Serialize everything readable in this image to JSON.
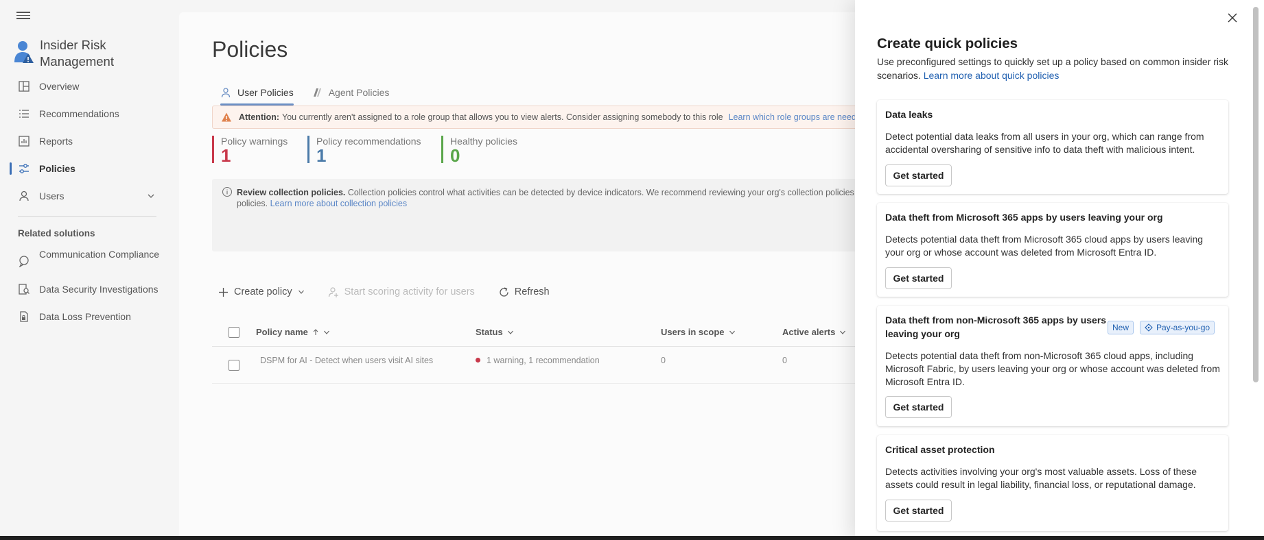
{
  "app": {
    "title": "Insider Risk Management"
  },
  "nav": {
    "items": [
      {
        "label": "Overview",
        "icon": "overview-icon"
      },
      {
        "label": "Recommendations",
        "icon": "list-icon"
      },
      {
        "label": "Reports",
        "icon": "chart-icon"
      },
      {
        "label": "Policies",
        "icon": "sliders-icon",
        "active": true
      },
      {
        "label": "Users",
        "icon": "person-icon",
        "expandable": true
      }
    ],
    "related_title": "Related solutions",
    "related": [
      {
        "label": "Communication Compliance",
        "icon": "chat-icon"
      },
      {
        "label": "Data Security Investigations",
        "icon": "investigate-icon"
      },
      {
        "label": "Data Loss Prevention",
        "icon": "lock-doc-icon"
      }
    ]
  },
  "main": {
    "title": "Policies",
    "tabs": [
      {
        "label": "User Policies",
        "active": true
      },
      {
        "label": "Agent Policies",
        "active": false
      }
    ],
    "attention": {
      "prefix": "Attention:",
      "text": "You currently aren't assigned to a role group that allows you to view alerts. Consider assigning somebody to this role",
      "link": "Learn which role groups are needed to re"
    },
    "stats": [
      {
        "label": "Policy warnings",
        "value": "1",
        "color": "#c8384a"
      },
      {
        "label": "Policy recommendations",
        "value": "1",
        "color": "#4a7aa8"
      },
      {
        "label": "Healthy policies",
        "value": "0",
        "color": "#5aa64a"
      }
    ],
    "info": {
      "bold": "Review collection policies.",
      "text": " Collection policies control what activities can be detected by device indicators. We recommend reviewing your org's collection policies to ensu",
      "text2": "policies.",
      "link": "Learn more about collection policies"
    },
    "toolbar": {
      "create": "Create policy",
      "start": "Start scoring activity for users",
      "refresh": "Refresh"
    },
    "table": {
      "headers": {
        "name": "Policy name",
        "status": "Status",
        "users": "Users in scope",
        "alerts": "Active alerts"
      },
      "rows": [
        {
          "name": "DSPM for AI - Detect when users visit AI sites",
          "status": "1 warning, 1 recommendation",
          "users": "0",
          "alerts": "0"
        }
      ]
    }
  },
  "panel": {
    "title": "Create quick policies",
    "desc": "Use preconfigured settings to quickly set up a policy based on common insider risk scenarios.",
    "desc_link": "Learn more about quick policies",
    "button_label": "Get started",
    "badges": {
      "new": "New",
      "payg": "Pay-as-you-go"
    },
    "cards": [
      {
        "title": "Data leaks",
        "desc": "Detect potential data leaks from all users in your org, which can range from accidental oversharing of sensitive info to data theft with malicious intent."
      },
      {
        "title": "Data theft from Microsoft 365 apps by users leaving your org",
        "desc": "Detects potential data theft from Microsoft 365 cloud apps by users leaving your org or whose account was deleted from Microsoft Entra ID."
      },
      {
        "title": "Data theft from non-Microsoft 365 apps by users leaving your org",
        "desc": "Detects potential data theft from non-Microsoft 365 cloud apps, including Microsoft Fabric, by users leaving your org or whose account was deleted from Microsoft Entra ID."
      },
      {
        "title": "Critical asset protection",
        "desc": "Detects activities involving your org's most valuable assets. Loss of these assets could result in legal liability, financial loss, or reputational damage."
      }
    ]
  }
}
